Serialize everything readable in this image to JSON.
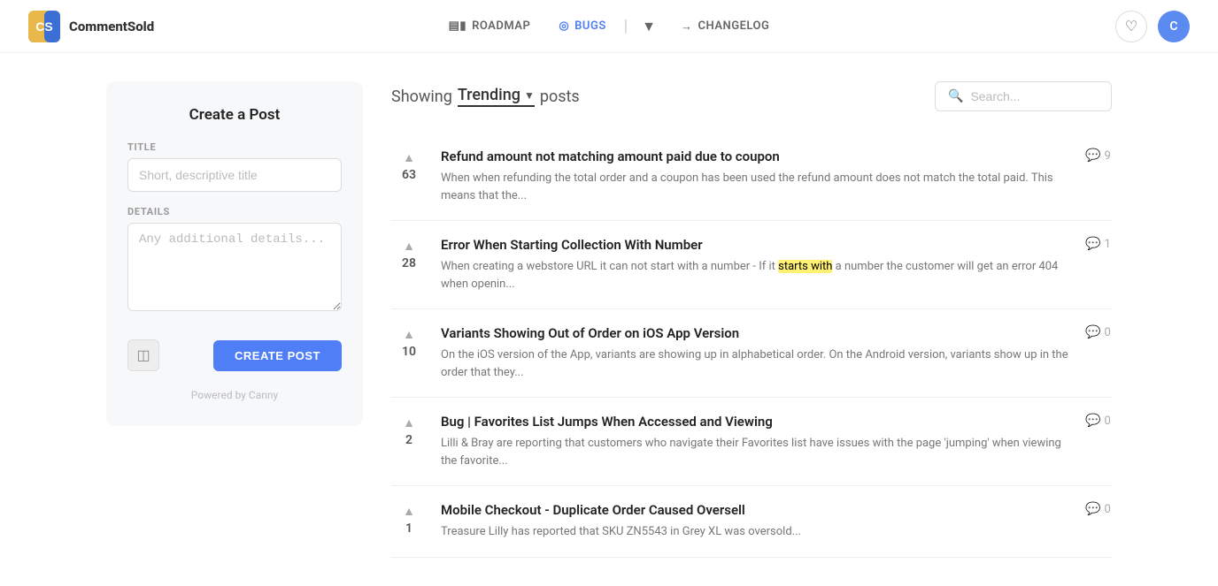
{
  "header": {
    "logo_text": "CS",
    "brand_name": "CommentSold",
    "nav": [
      {
        "id": "roadmap",
        "label": "ROADMAP",
        "icon": "chart-icon",
        "active": false
      },
      {
        "id": "bugs",
        "label": "BUGS",
        "icon": "target-icon",
        "active": true
      },
      {
        "id": "changelog",
        "label": "CHANGELOG",
        "icon": "arrow-icon",
        "active": false
      }
    ],
    "avatar_letter": "C"
  },
  "create_post": {
    "title": "Create a Post",
    "title_label": "TITLE",
    "title_placeholder": "Short, descriptive title",
    "details_label": "DETAILS",
    "details_placeholder": "Any additional details...",
    "create_button": "CREATE POST",
    "powered_by": "Powered by Canny"
  },
  "posts_list": {
    "showing_label": "Showing",
    "trending_label": "Trending",
    "posts_label": "posts",
    "search_placeholder": "Search...",
    "posts": [
      {
        "id": 1,
        "votes": 63,
        "title": "Refund amount not matching amount paid due to coupon",
        "excerpt": "When when refunding the total order and a coupon has been used the refund amount does not match the total paid. This means that the...",
        "comments": 9
      },
      {
        "id": 2,
        "votes": 28,
        "title": "Error When Starting Collection With Number",
        "excerpt": "When creating a webstore URL it can not start with a number - If it starts with a number the customer will get an error 404 when openin...",
        "comments": 1,
        "has_highlight": true,
        "highlight_word": "starts with"
      },
      {
        "id": 3,
        "votes": 10,
        "title": "Variants Showing Out of Order on iOS App Version",
        "excerpt": "On the iOS version of the App, variants are showing up in alphabetical order. On the Android version, variants show up in the order that they...",
        "comments": 0
      },
      {
        "id": 4,
        "votes": 2,
        "title": "Bug | Favorites List Jumps When Accessed and Viewing",
        "excerpt": "Lilli & Bray are reporting that customers who navigate their Favorites list have issues with the page 'jumping' when viewing the favorite...",
        "comments": 0
      },
      {
        "id": 5,
        "votes": 1,
        "title": "Mobile Checkout - Duplicate Order Caused Oversell",
        "excerpt": "Treasure Lilly has reported that SKU ZN5543 in Grey XL was oversold...",
        "comments": 0
      }
    ]
  }
}
